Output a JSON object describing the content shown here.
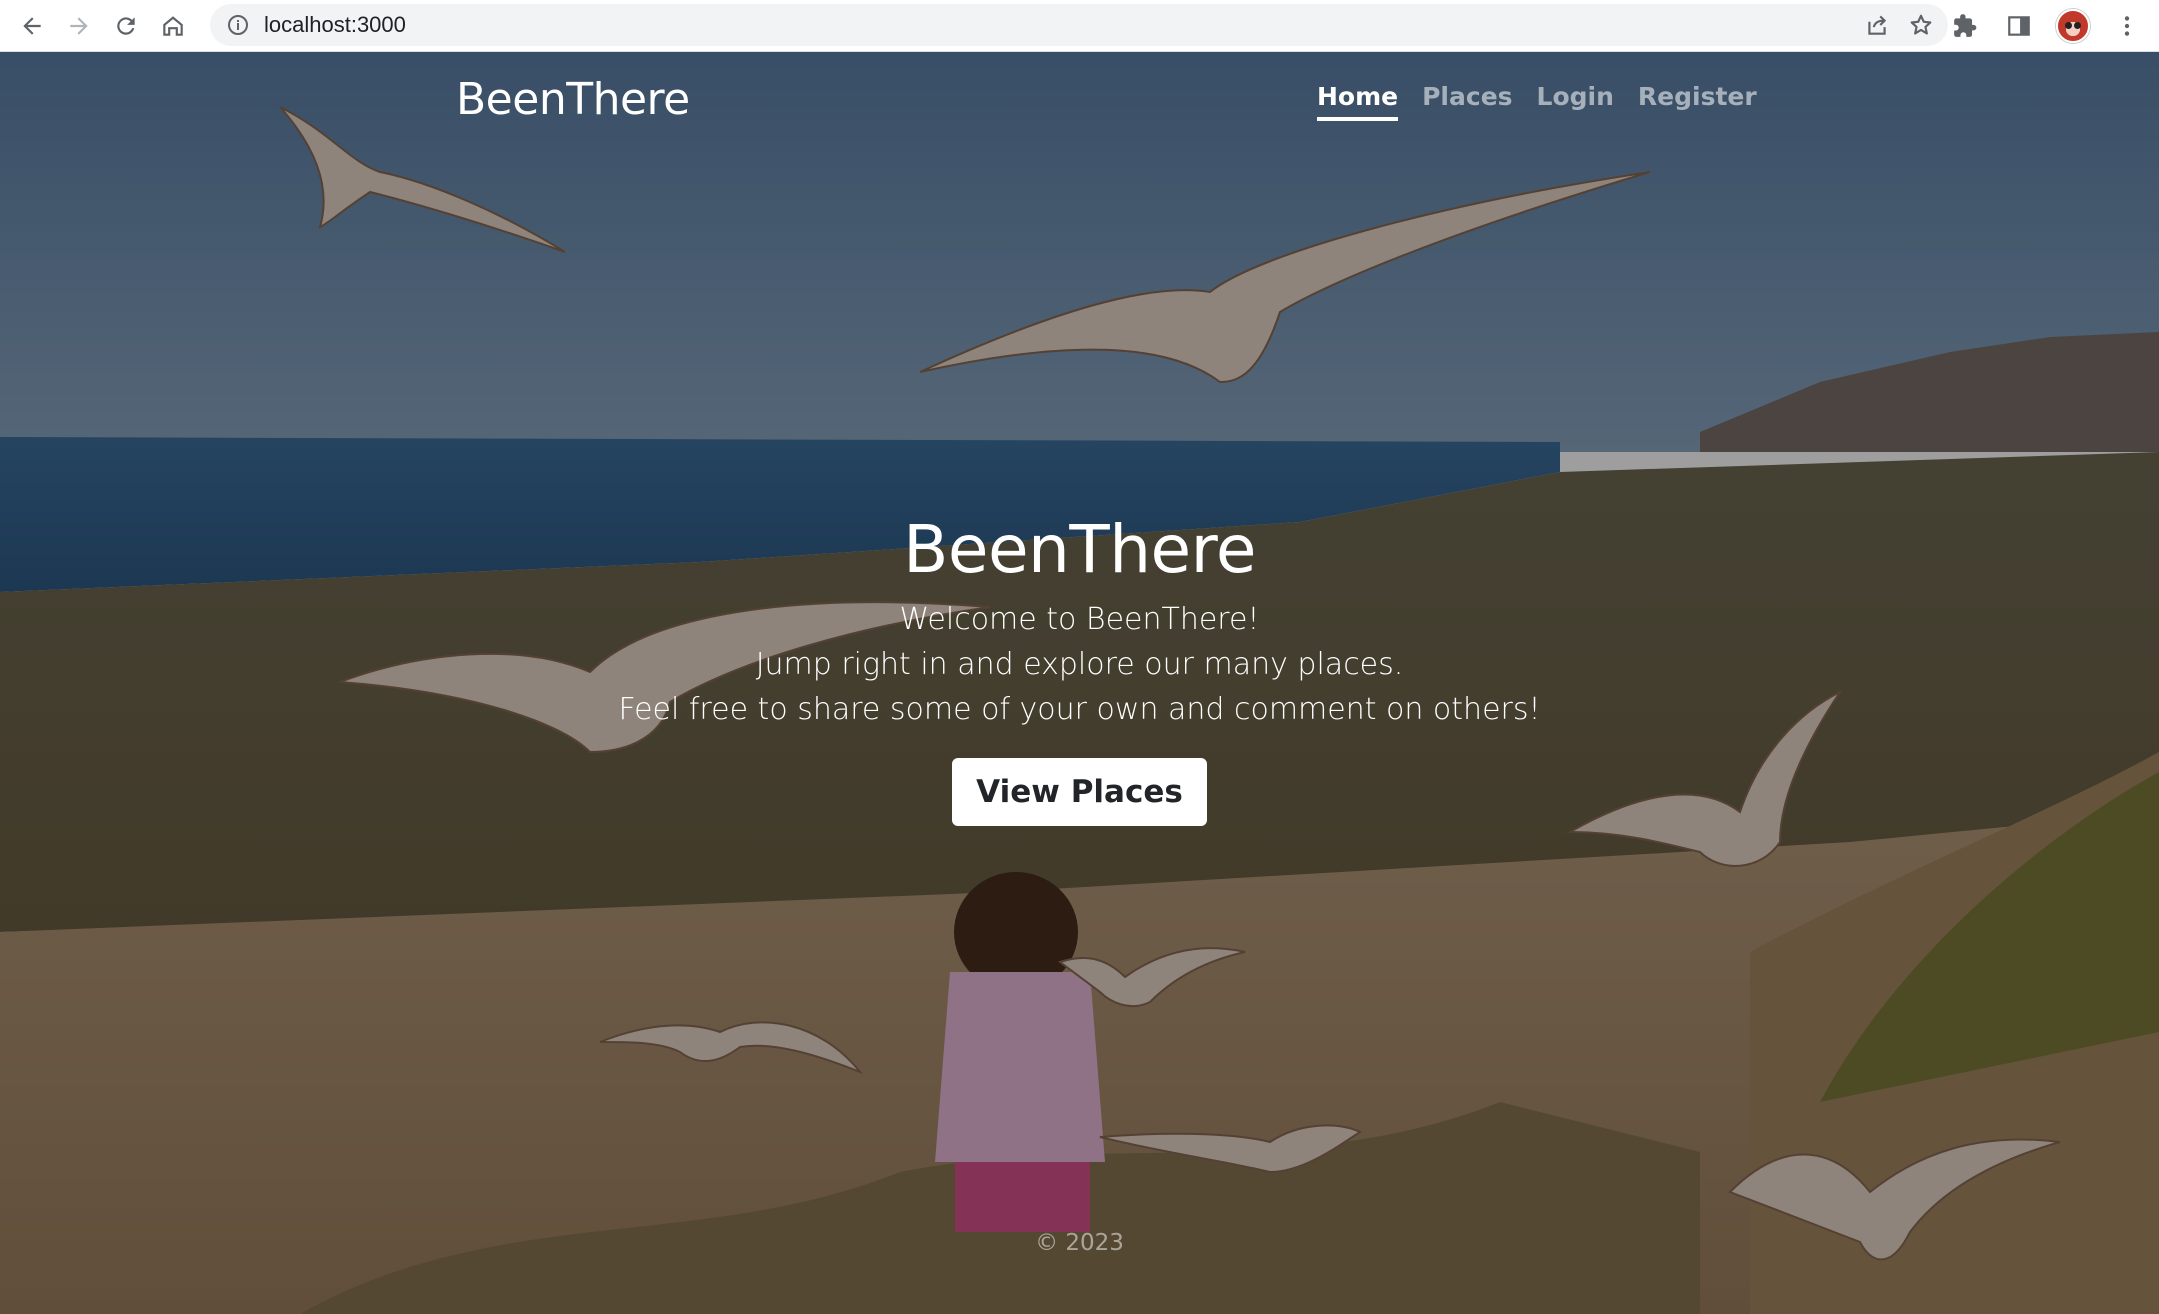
{
  "browser": {
    "url": "localhost:3000",
    "icons": {
      "back": "arrow-left-icon",
      "forward": "arrow-right-icon",
      "reload": "reload-icon",
      "home": "home-icon",
      "info": "info-icon",
      "share": "share-icon",
      "bookmark": "star-icon",
      "extensions": "puzzle-icon",
      "side_panel": "side-panel-icon",
      "profile": "avatar",
      "menu": "kebab-menu-icon"
    }
  },
  "site": {
    "brand": "BeenThere",
    "nav": {
      "home": "Home",
      "places": "Places",
      "login": "Login",
      "register": "Register"
    },
    "hero": {
      "title": "BeenThere",
      "line1": "Welcome to BeenThere!",
      "line2": "Jump right in and explore our many places.",
      "line3": "Feel free to share some of your own and comment on others!",
      "cta": "View Places"
    },
    "footer": "© 2023"
  },
  "colors": {
    "overlay": "#000000",
    "text": "#ffffff",
    "button_bg": "#ffffff",
    "button_text": "#212529"
  }
}
